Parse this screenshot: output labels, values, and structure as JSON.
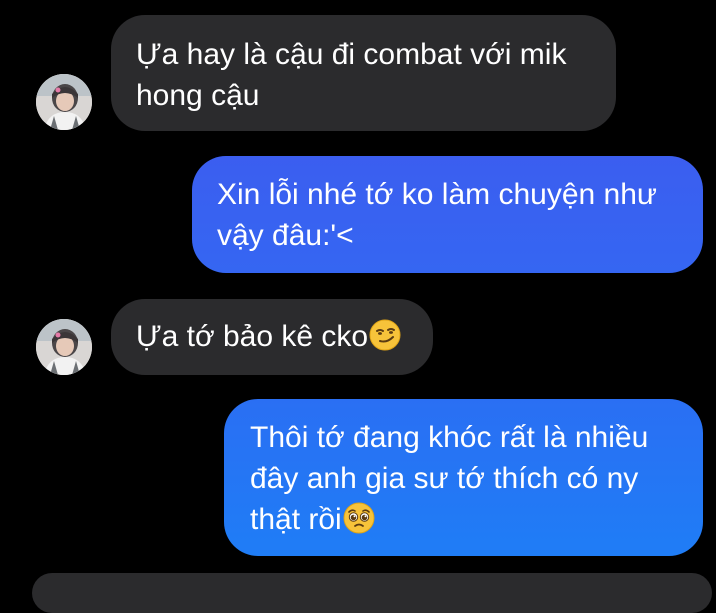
{
  "conversation": {
    "messages": [
      {
        "side": "incoming",
        "lines": [
          "Ựa hay là cậu đi combat với mik",
          "hong cậu"
        ]
      },
      {
        "side": "outgoing",
        "lines": [
          "Xin lỗi nhé tớ ko làm chuyện như",
          "vậy đâu:'<"
        ]
      },
      {
        "side": "incoming",
        "lines": [
          "Ựa tớ bảo kê cko"
        ],
        "emoji": "smirking-face-icon"
      },
      {
        "side": "outgoing",
        "lines": [
          "Thôi tớ đang khóc rất là nhiều",
          "đây anh gia sư tớ thích có ny",
          "thật rồi"
        ],
        "emoji": "pleading-face-icon"
      }
    ]
  },
  "colors": {
    "background": "#000000",
    "incoming_bubble": "#2b2b2d",
    "outgoing_gradient_top": "#3a5cf0",
    "outgoing_gradient_bottom": "#1f79f5",
    "text": "#ffffff"
  }
}
